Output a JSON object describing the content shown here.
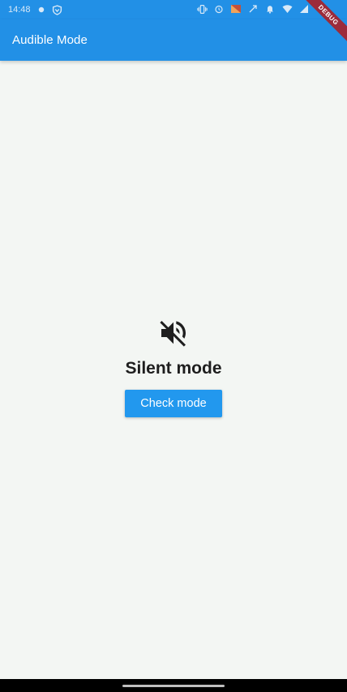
{
  "status_bar": {
    "time": "14:48",
    "icons": [
      "notification-dot-icon",
      "shield-icon",
      "vibrate-icon",
      "alarm-icon",
      "app-icon",
      "rotate-icon",
      "bell-icon",
      "wifi-icon",
      "signal-icon",
      "battery-icon"
    ]
  },
  "app_bar": {
    "title": "Audible Mode",
    "color": "#2290e6"
  },
  "debug_banner": {
    "label": "DEBUG",
    "color": "#9c2b3a"
  },
  "main": {
    "mode_icon": "volume-off-icon",
    "mode_label": "Silent mode",
    "check_button_label": "Check mode",
    "button_color": "#2298ee"
  }
}
